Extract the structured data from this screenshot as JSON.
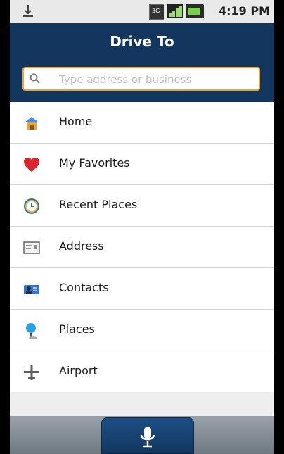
{
  "status_bar": {
    "time": "4:19 PM",
    "icons": [
      "usb-icon",
      "3g-icon",
      "signal-icon",
      "battery-icon"
    ]
  },
  "header": {
    "title": "Drive To"
  },
  "search": {
    "placeholder": "Type address or business"
  },
  "menu": {
    "items": [
      {
        "label": "Home",
        "icon": "home-icon"
      },
      {
        "label": "My Favorites",
        "icon": "heart-icon"
      },
      {
        "label": "Recent Places",
        "icon": "clock-icon"
      },
      {
        "label": "Address",
        "icon": "address-card-icon"
      },
      {
        "label": "Contacts",
        "icon": "contacts-icon"
      },
      {
        "label": "Places",
        "icon": "pin-icon"
      },
      {
        "label": "Airport",
        "icon": "airplane-icon"
      }
    ]
  },
  "bottom_bar": {
    "voice_icon": "microphone-icon"
  },
  "colors": {
    "header_bg": "#12365d",
    "search_border": "#f2a431",
    "battery": "#7ad24a"
  }
}
